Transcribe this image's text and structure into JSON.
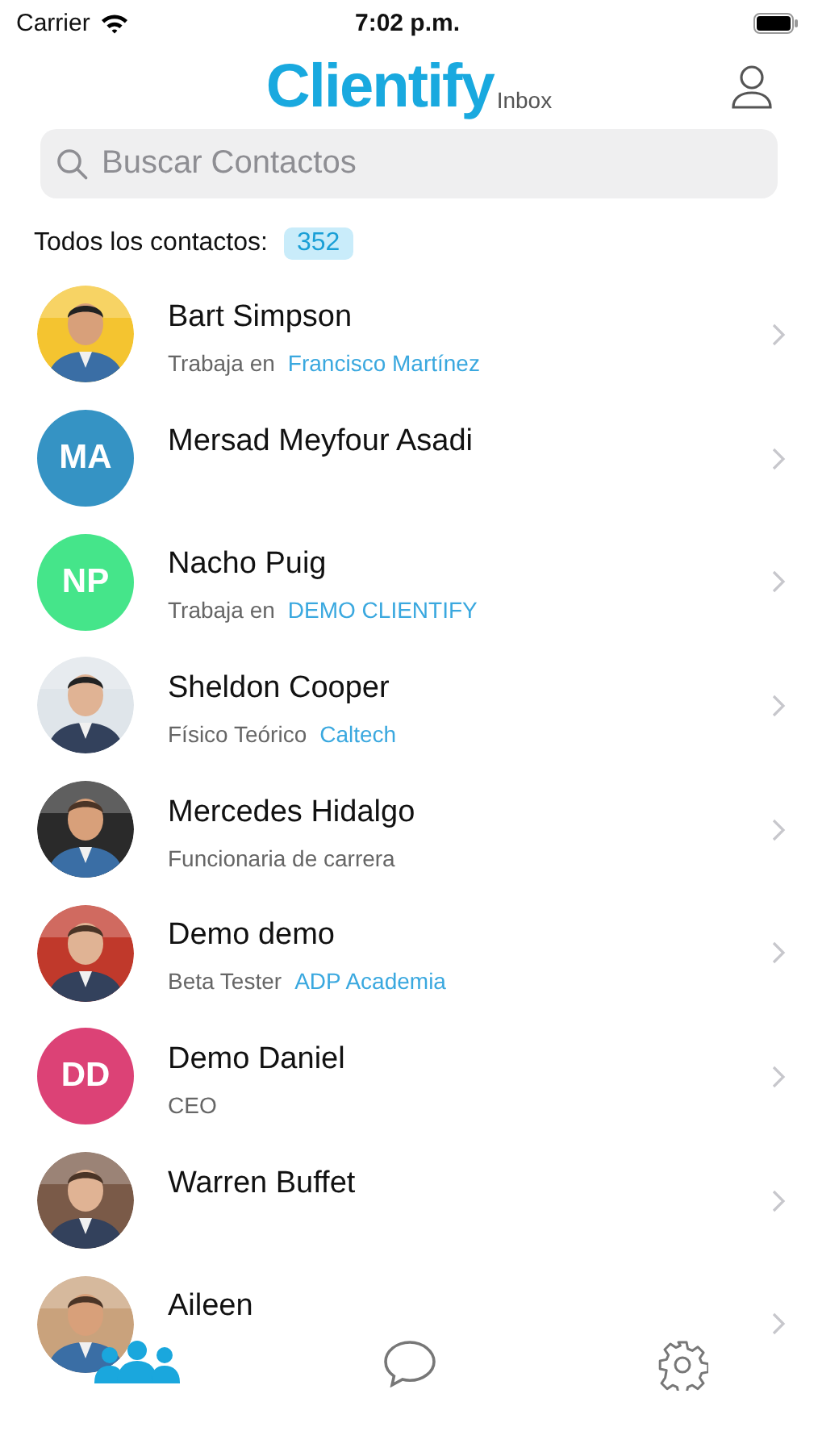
{
  "status_bar": {
    "carrier": "Carrier",
    "time": "7:02 p.m."
  },
  "header": {
    "logo": "Clientify",
    "logo_suffix": "Inbox"
  },
  "search": {
    "placeholder": "Buscar Contactos"
  },
  "count": {
    "label": "Todos los contactos:",
    "value": "352"
  },
  "contacts": [
    {
      "name": "Bart Simpson",
      "subtitle": "Trabaja en",
      "company": "Francisco Martínez"
    },
    {
      "name": "Mersad Meyfour Asadi",
      "avatar": {
        "kind": "initials",
        "initials": "MA",
        "color": "#3593c4"
      }
    },
    {
      "name": "Nacho Puig",
      "avatar": {
        "kind": "initials",
        "initials": "NP",
        "color": "#45e58a"
      },
      "subtitle": "Trabaja en",
      "company": "DEMO CLIENTIFY"
    },
    {
      "name": "Sheldon Cooper",
      "subtitle": "Físico Teórico",
      "company": "Caltech"
    },
    {
      "name": "Mercedes Hidalgo",
      "subtitle": "Funcionaria de carrera"
    },
    {
      "name": "Demo demo",
      "subtitle": "Beta Tester",
      "company": "ADP Academia"
    },
    {
      "name": "Demo Daniel",
      "avatar": {
        "kind": "initials",
        "initials": "DD",
        "color": "#dc4276"
      },
      "subtitle": "CEO"
    },
    {
      "name": "Warren Buffet"
    },
    {
      "name": "Aileen"
    }
  ],
  "tabs": [
    {
      "kind": "contacts",
      "selected": true
    },
    {
      "kind": "messages",
      "selected": false
    },
    {
      "kind": "settings",
      "selected": false
    }
  ]
}
